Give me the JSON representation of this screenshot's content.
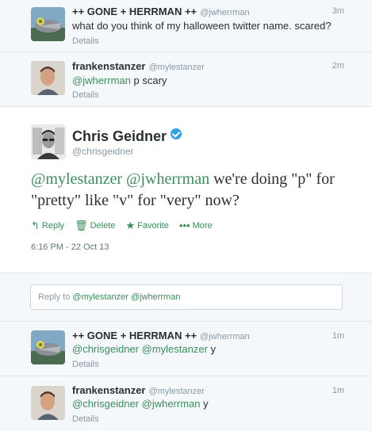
{
  "tweets_above": [
    {
      "name": "++ GONE + HERRMAN ++",
      "handle": "@jwherrman",
      "time": "3m",
      "text_plain": "what do you think of my halloween twitter name. scared?",
      "details": "Details",
      "avatar_icon": "ghost-avatar-icon"
    },
    {
      "name": "frankenstanzer",
      "handle": "@mylestanzer",
      "time": "2m",
      "mention": "@jwherrman",
      "text_rest": " p scary",
      "details": "Details",
      "avatar_icon": "person-avatar-icon"
    }
  ],
  "focus_tweet": {
    "name": "Chris Geidner",
    "handle": "@chrisgeidner",
    "mention1": "@mylestanzer",
    "mention2": "@jwherrman",
    "text_rest": " we're doing \"p\" for \"pretty\" like \"v\" for \"very\" now?",
    "actions": {
      "reply": "Reply",
      "delete": "Delete",
      "favorite": "Favorite",
      "more": "More"
    },
    "date": "6:16 PM - 22 Oct 13"
  },
  "reply_box": {
    "prefix": "Reply to ",
    "mentions": "@mylestanzer @jwherrman"
  },
  "tweets_below": [
    {
      "name": "++ GONE + HERRMAN ++",
      "handle": "@jwherrman",
      "time": "1m",
      "mention": "@chrisgeidner @mylestanzer",
      "text_rest": " y",
      "details": "Details"
    },
    {
      "name": "frankenstanzer",
      "handle": "@mylestanzer",
      "time": "1m",
      "mention": "@chrisgeidner @jwherrman",
      "text_rest": " y",
      "details": "Details"
    }
  ],
  "colors": {
    "link_green": "#3a8d5b",
    "muted": "#8899a6",
    "verified_blue": "#2fa3e6"
  }
}
